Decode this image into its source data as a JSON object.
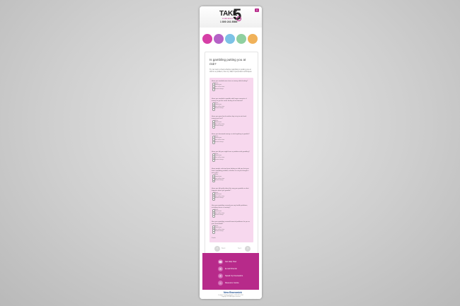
{
  "brand": {
    "take": "TAKE",
    "five": "5",
    "tagline": "to talk about it",
    "phone": "1 800 241 8588",
    "menu_glyph": "≡",
    "accent": "#b72a8a"
  },
  "circles": [
    {
      "label": "",
      "color": "#d63fa6"
    },
    {
      "label": "",
      "color": "#b562c6"
    },
    {
      "label": "",
      "color": "#7cc2e6"
    },
    {
      "label": "",
      "color": "#8fd0a0"
    },
    {
      "label": "",
      "color": "#f0b25a"
    }
  ],
  "quiz": {
    "title": "Is gambling putting you at risk?",
    "intro": "Try our test to check whether gambling is putting you at risk for a problem, then try Take 5 prevention techniques.",
    "questions": [
      {
        "text": "Have you needed more time or money while betting?",
        "options": [
          "Never",
          "Sometimes",
          "Most of the time",
          "Almost always"
        ]
      },
      {
        "text": "Have you needed to gamble with larger amounts of money to get the same feeling of excitement?",
        "options": [
          "Never",
          "Sometimes",
          "Most of the time",
          "Almost always"
        ]
      },
      {
        "text": "Have you gone back another day to try to win back money you lost?",
        "options": [
          "Never",
          "Sometimes",
          "Most of the time",
          "Almost always"
        ]
      },
      {
        "text": "Have you borrowed money or sold anything to gamble?",
        "options": [
          "Never",
          "Sometimes",
          "Most of the time",
          "Almost always"
        ]
      },
      {
        "text": "Have you felt you might have a problem with gambling?",
        "options": [
          "Never",
          "Sometimes",
          "Most of the time",
          "Almost always"
        ]
      },
      {
        "text": "Have people criticized your betting or told you that you had a gambling problem, whether or not you thought it was true?",
        "options": [
          "Never",
          "Sometimes",
          "Most of the time",
          "Almost always"
        ]
      },
      {
        "text": "Have you felt guilty about the way you gamble or what happens when you gamble?",
        "options": [
          "Never",
          "Sometimes",
          "Most of the time",
          "Almost always"
        ]
      },
      {
        "text": "Has your gambling caused you any health problems, including stress or anxiety?",
        "options": [
          "Never",
          "Sometimes",
          "Most of the time",
          "Almost always"
        ]
      },
      {
        "text": "Has your gambling caused financial problems for you or your household?",
        "options": [
          "Never",
          "Sometimes",
          "Most of the time",
          "Almost always"
        ]
      }
    ],
    "finish": "Finish",
    "prev_label": "Back",
    "next_label": "Next",
    "prev_glyph": "‹",
    "next_glyph": "›"
  },
  "footer": {
    "items": [
      {
        "icon": "phone-icon",
        "glyph": "☎",
        "label": "Get Help Now"
      },
      {
        "icon": "mail-icon",
        "glyph": "✉",
        "label": "E-mail Friends"
      },
      {
        "icon": "chat-icon",
        "glyph": "✆",
        "label": "Speak Up Counselors"
      },
      {
        "icon": "people-icon",
        "glyph": "☺",
        "label": "Resource Centre"
      }
    ]
  },
  "gov": {
    "logo": "New Brunswick",
    "text": "Problem Gambling Helpline 1-800-461-1234 Copyright 2013 All rights reserved"
  }
}
